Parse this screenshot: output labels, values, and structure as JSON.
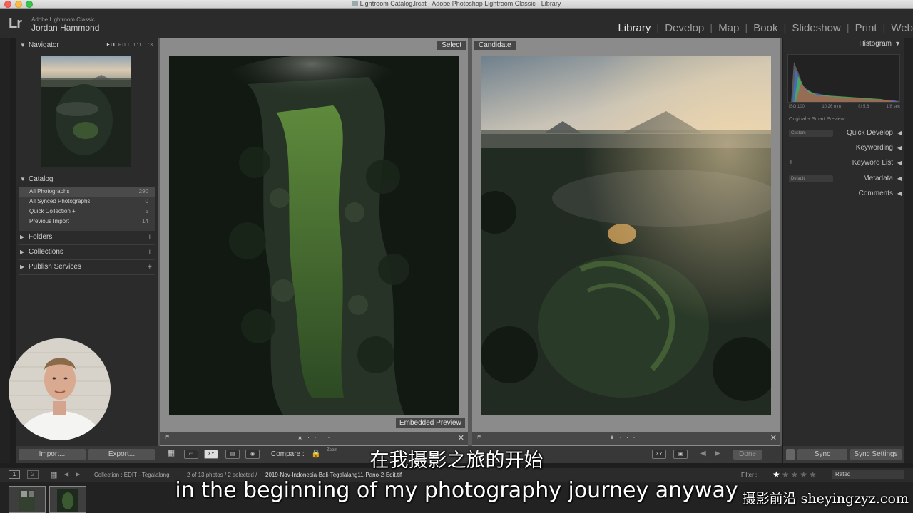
{
  "window": {
    "title": "Lightroom Catalog.lrcat - Adobe Photoshop Lightroom Classic - Library"
  },
  "identity": {
    "logo": "Lr",
    "app_line": "Adobe Lightroom Classic",
    "user_name": "Jordan Hammond"
  },
  "modules": [
    "Library",
    "Develop",
    "Map",
    "Book",
    "Slideshow",
    "Print",
    "Web"
  ],
  "module_separator": "|",
  "active_module": "Library",
  "left_panel": {
    "navigator": {
      "title": "Navigator",
      "zoom_fit": "FIT",
      "zoom_fill": "FILL",
      "zoom_1": "1:1",
      "zoom_2": "1:3"
    },
    "catalog": {
      "title": "Catalog",
      "items": [
        {
          "label": "All Photographs",
          "count": "290"
        },
        {
          "label": "All Synced Photographs",
          "count": "0"
        },
        {
          "label": "Quick Collection +",
          "count": "5"
        },
        {
          "label": "Previous Import",
          "count": "14"
        }
      ]
    },
    "folders": "Folders",
    "collections": "Collections",
    "publish_services": "Publish Services",
    "import_label": "Import...",
    "export_label": "Export..."
  },
  "compare": {
    "select_label": "Select",
    "candidate_label": "Candidate",
    "embedded_preview": "Embedded Preview"
  },
  "toolbar": {
    "compare_label": "Compare :",
    "zoom_label": "Zoom",
    "done_label": "Done",
    "xy_label": "XY"
  },
  "right_panel": {
    "histogram": "Histogram",
    "hist_info": [
      "ISO 100",
      "10.26 mm",
      "f / 5.6",
      "1/8 sec"
    ],
    "preview_note": "Original + Smart Preview",
    "custom_preset": "Custom",
    "quick_develop": "Quick Develop",
    "keywording": "Keywording",
    "keyword_list": "Keyword List",
    "default_preset": "Default",
    "metadata": "Metadata",
    "comments": "Comments",
    "sync_label": "Sync",
    "sync_settings_label": "Sync Settings"
  },
  "filmstrip": {
    "view1": "1",
    "view2": "2",
    "source": "Collection : EDIT - Tegalalang",
    "info": "2 of 13 photos / 2 selected /",
    "filename": "2019-Nov-Indonesia-Bali-Tegalalang11-Pano-2-Edit.tif",
    "filter_label": "Filter :",
    "rated_label": "Rated"
  },
  "subtitles": {
    "chinese": "在我摄影之旅的开始",
    "english": "in the beginning of my photography journey anyway",
    "watermark": "摄影前沿 sheyingzyz.com"
  }
}
